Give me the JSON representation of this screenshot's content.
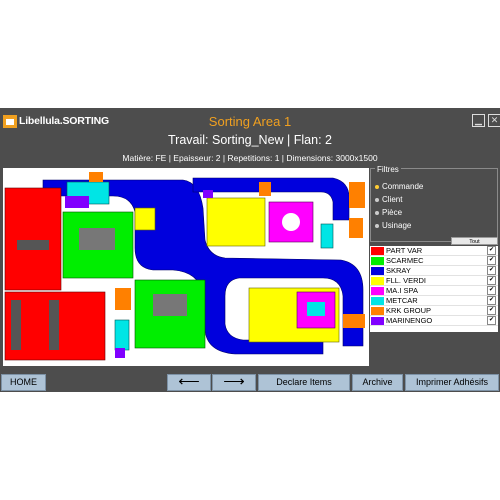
{
  "header": {
    "logo_text": "Libellula.SORTING",
    "area_title": "Sorting Area 1",
    "job_line": "Travail: Sorting_New | Flan: 2",
    "info_line": "Matière: FE | Epaisseur: 2 | Repetitions: 1 | Dimensions: 3000x1500",
    "minimize_label": "▁",
    "close_label": "✕"
  },
  "filters": {
    "title": "Filtres",
    "options": [
      {
        "label": "Commande",
        "selected": true
      },
      {
        "label": "Client",
        "selected": false
      },
      {
        "label": "Pièce",
        "selected": false
      },
      {
        "label": "Usinage",
        "selected": false
      }
    ],
    "deselect_label": "Tout désélectionner"
  },
  "clients": [
    {
      "name": "PART VAR",
      "color": "#ff0000",
      "checked": true
    },
    {
      "name": "SCARMEC",
      "color": "#00ee00",
      "checked": true
    },
    {
      "name": "SKRAY",
      "color": "#0000dd",
      "checked": true
    },
    {
      "name": "FLL. VERDI",
      "color": "#ffff00",
      "checked": true
    },
    {
      "name": "MA.I SPA",
      "color": "#ff00ff",
      "checked": true
    },
    {
      "name": "METCAR",
      "color": "#00e5e5",
      "checked": true
    },
    {
      "name": "KRK GROUP",
      "color": "#ff8000",
      "checked": true
    },
    {
      "name": "MARINENGO",
      "color": "#8000ff",
      "checked": true
    }
  ],
  "toolbar": {
    "home": "HOME",
    "prev": "⟵",
    "next": "⟶",
    "declare": "Declare Items",
    "archive": "Archive",
    "print": "Imprimer Adhésifs"
  },
  "colors": {
    "background": "#4d4d4d",
    "accent": "#f0a020",
    "button": "#aec3d6"
  }
}
